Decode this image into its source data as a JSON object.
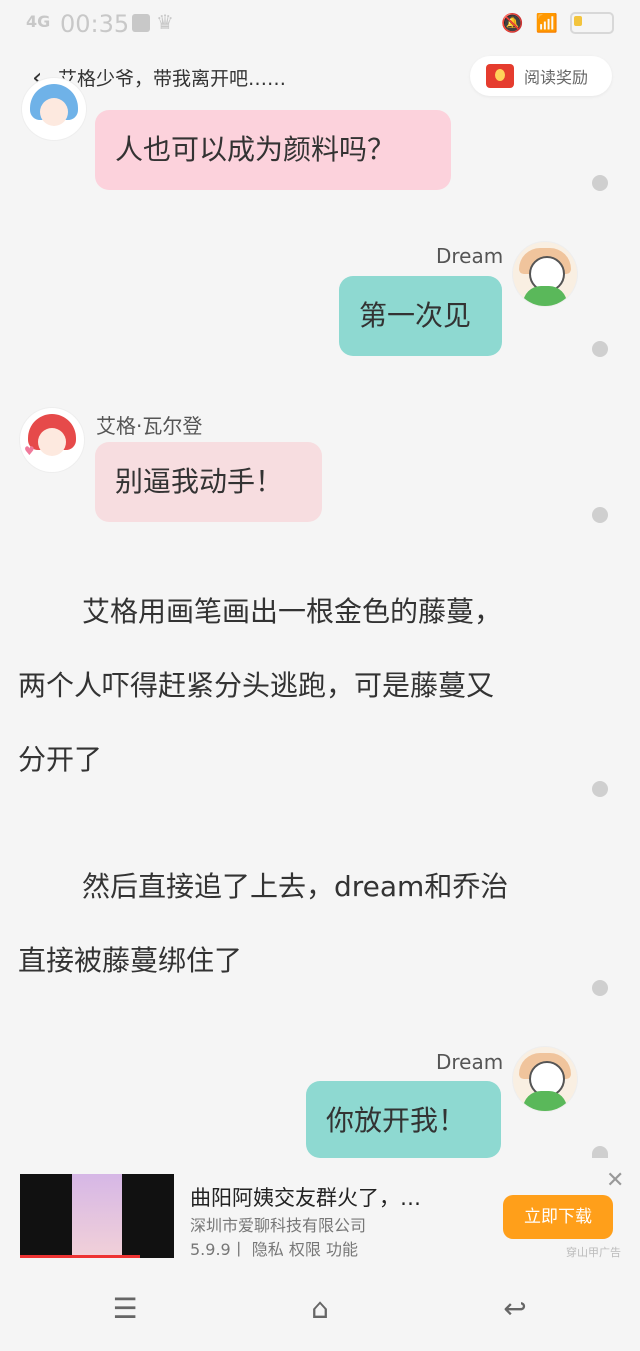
{
  "status_bar": {
    "time": "00:35",
    "signal": "4G",
    "battery": "4"
  },
  "header": {
    "back_icon": "‹",
    "title": "艾格少爷，带我离开吧……",
    "reward_label": "阅读奖励"
  },
  "messages": [
    {
      "speaker": "",
      "text": "人也可以成为颜料吗？",
      "side": "left",
      "color": "#fcd2dc"
    },
    {
      "speaker": "Dream",
      "text": "第一次见",
      "side": "right",
      "color": "#8ed9d1"
    },
    {
      "speaker": "艾格·瓦尔登",
      "text": "别逼我动手！",
      "side": "left",
      "color": "#f7dde0"
    }
  ],
  "narration": [
    {
      "line1": "艾格用画笔画出一根金色的藤蔓，",
      "line2": "两个人吓得赶紧分头逃跑，可是藤蔓又",
      "line3": "分开了"
    },
    {
      "line1": "然后直接追了上去，dream和乔治",
      "line2": "直接被藤蔓绑住了"
    }
  ],
  "last_message": {
    "speaker": "Dream",
    "text": "你放开我！"
  },
  "ad": {
    "title": "曲阳阿姨交友群火了，…",
    "company": "深圳市爱聊科技有限公司",
    "meta": "5.9.9丨 隐私  权限  功能",
    "download": "立即下载",
    "close": "✕",
    "label": "穿山甲广告"
  },
  "nav": {
    "menu": "☰",
    "home": "⌂",
    "back": "↩"
  }
}
